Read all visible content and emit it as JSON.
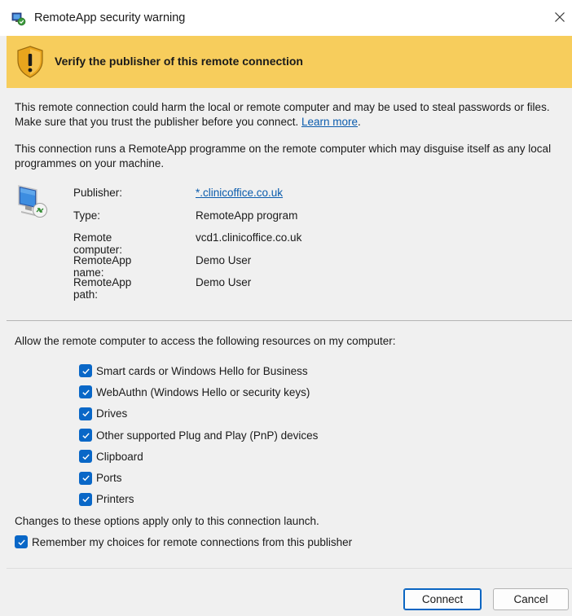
{
  "window": {
    "title": "RemoteApp security warning"
  },
  "banner": {
    "heading": "Verify the publisher of this remote connection"
  },
  "warning": {
    "paragraph1": "This remote connection could harm the local or remote computer and may be used to steal passwords or files. Make sure that you trust the publisher before you connect.",
    "learn_more": "Learn more",
    "period": ".",
    "paragraph2": "This connection runs a RemoteApp programme on the remote computer which may disguise itself as any local programmes on your machine."
  },
  "details": {
    "publisher_label": "Publisher:",
    "publisher_value": "*.clinicoffice.co.uk",
    "type_label": "Type:",
    "type_value": "RemoteApp program",
    "remote_computer_label": "Remote computer:",
    "remote_computer_value": "vcd1.clinicoffice.co.uk",
    "remoteapp_name_label": "RemoteApp name:",
    "remoteapp_name_value": "Demo User",
    "remoteapp_path_label": "RemoteApp path:",
    "remoteapp_path_value": "Demo User"
  },
  "resources": {
    "intro": "Allow the remote computer to access the following resources on my computer:",
    "items": [
      {
        "label": "Smart cards or Windows Hello for Business",
        "checked": true
      },
      {
        "label": "WebAuthn (Windows Hello or security keys)",
        "checked": true
      },
      {
        "label": "Drives",
        "checked": true
      },
      {
        "label": "Other supported Plug and Play (PnP) devices",
        "checked": true
      },
      {
        "label": "Clipboard",
        "checked": true
      },
      {
        "label": "Ports",
        "checked": true
      },
      {
        "label": "Printers",
        "checked": true
      }
    ],
    "changes_note": "Changes to these options apply only to this connection launch.",
    "remember_label": "Remember my choices for remote connections from this publisher",
    "remember_checked": true
  },
  "buttons": {
    "connect": "Connect",
    "cancel": "Cancel"
  },
  "colors": {
    "banner": "#f7cd5c",
    "checkbox": "#0967c7",
    "link": "#0b5cad"
  }
}
